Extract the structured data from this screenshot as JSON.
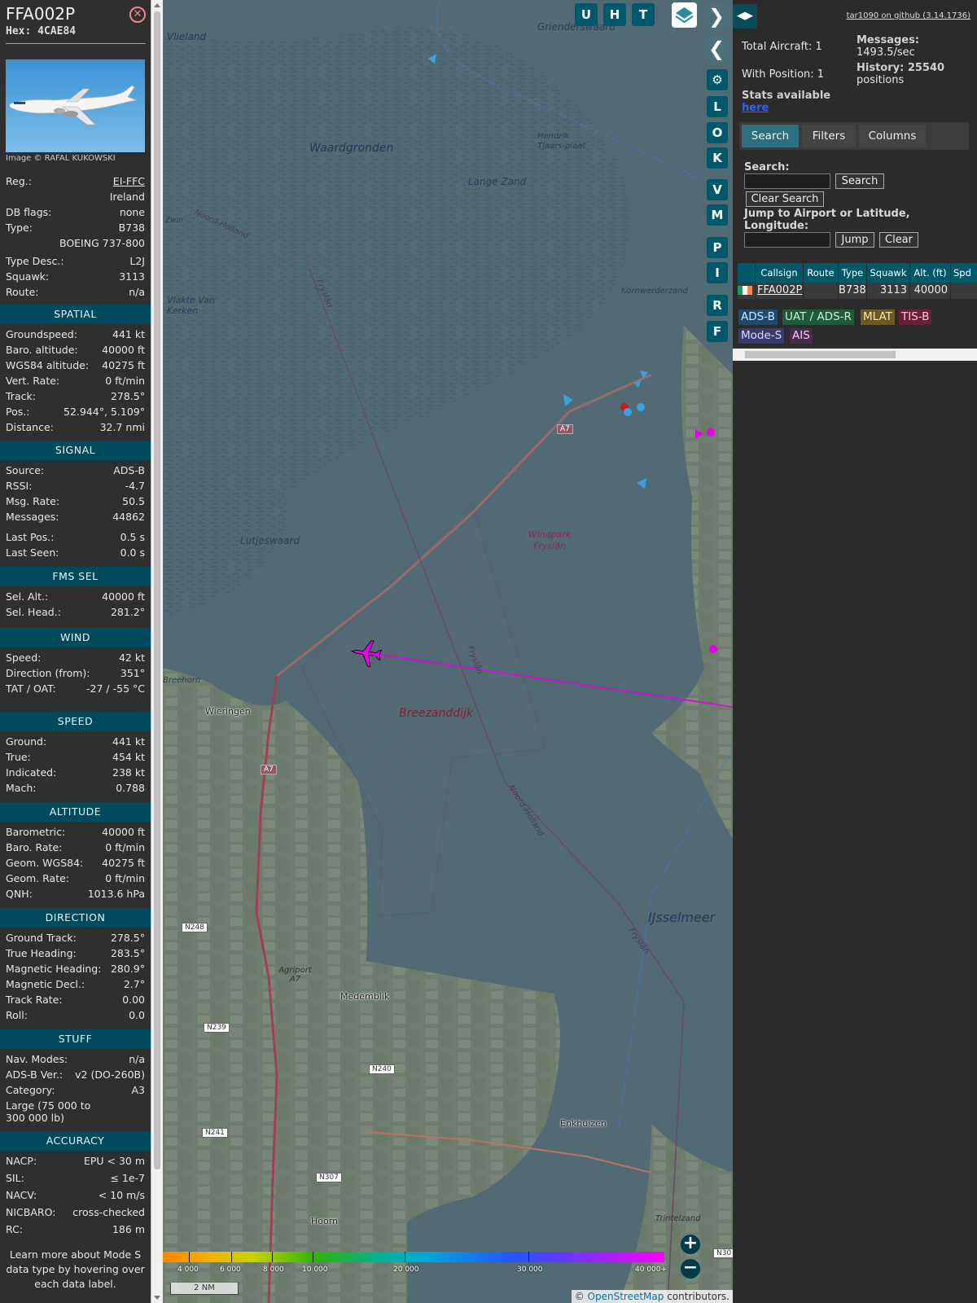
{
  "selected": {
    "callsign": "FFA002P",
    "hex": "Hex: 4CAE84",
    "photo_credit": "Image © RAFAL KUKOWSKI",
    "rows_top": [
      {
        "k": "Reg.:",
        "v": "EI-FFC",
        "link": true
      },
      {
        "k": "",
        "v": "Ireland"
      },
      {
        "k": "DB flags:",
        "v": "none"
      },
      {
        "k": "Type:",
        "v": "B738"
      },
      {
        "k": "",
        "v": "BOEING 737-800"
      },
      {
        "k": "Type Desc.:",
        "v": "L2J"
      },
      {
        "k": "Squawk:",
        "v": "3113"
      },
      {
        "k": "Route:",
        "v": "n/a"
      }
    ]
  },
  "sections": [
    {
      "title": "SPATIAL",
      "rows": [
        {
          "k": "Groundspeed:",
          "v": "441 kt"
        },
        {
          "k": "Baro. altitude:",
          "v": "40000 ft"
        },
        {
          "k": "WGS84 altitude:",
          "v": "40275 ft"
        },
        {
          "k": "Vert. Rate:",
          "v": "0 ft/min"
        },
        {
          "k": "Track:",
          "v": "278.5°"
        },
        {
          "k": "Pos.:",
          "v": "52.944°, 5.109°"
        },
        {
          "k": "Distance:",
          "v": "32.7 nmi"
        }
      ]
    },
    {
      "title": "SIGNAL",
      "rows": [
        {
          "k": "Source:",
          "v": "ADS-B"
        },
        {
          "k": "RSSI:",
          "v": "-4.7"
        },
        {
          "k": "Msg. Rate:",
          "v": "50.5"
        },
        {
          "k": "Messages:",
          "v": "44862"
        },
        {
          "k": "Last Pos.:",
          "v": "0.5 s"
        },
        {
          "k": "Last Seen:",
          "v": "0.0 s"
        }
      ]
    },
    {
      "title": "FMS SEL",
      "rows": [
        {
          "k": "Sel. Alt.:",
          "v": "40000 ft"
        },
        {
          "k": "Sel. Head.:",
          "v": "281.2°"
        }
      ]
    },
    {
      "title": "WIND",
      "rows": [
        {
          "k": "Speed:",
          "v": "42 kt"
        },
        {
          "k": "Direction (from):",
          "v": "351°"
        },
        {
          "k": "TAT / OAT:",
          "v": "-27 / -55 °C"
        }
      ]
    },
    {
      "title": "SPEED",
      "rows": [
        {
          "k": "Ground:",
          "v": "441 kt"
        },
        {
          "k": "True:",
          "v": "454 kt"
        },
        {
          "k": "Indicated:",
          "v": "238 kt"
        },
        {
          "k": "Mach:",
          "v": "0.788"
        }
      ]
    },
    {
      "title": "ALTITUDE",
      "rows": [
        {
          "k": "Barometric:",
          "v": "40000 ft"
        },
        {
          "k": "Baro. Rate:",
          "v": "0 ft/min"
        },
        {
          "k": "Geom. WGS84:",
          "v": "40275 ft"
        },
        {
          "k": "Geom. Rate:",
          "v": "0 ft/min"
        },
        {
          "k": "QNH:",
          "v": "1013.6 hPa"
        }
      ]
    },
    {
      "title": "DIRECTION",
      "rows": [
        {
          "k": "Ground Track:",
          "v": "278.5°"
        },
        {
          "k": "True Heading:",
          "v": "283.5°"
        },
        {
          "k": "Magnetic Heading:",
          "v": "280.9°"
        },
        {
          "k": "Magnetic Decl.:",
          "v": "2.7°"
        },
        {
          "k": "Track Rate:",
          "v": "0.00"
        },
        {
          "k": "Roll:",
          "v": "0.0"
        }
      ]
    },
    {
      "title": "STUFF",
      "rows": [
        {
          "k": "Nav. Modes:",
          "v": "n/a"
        },
        {
          "k": "ADS-B Ver.:",
          "v": "v2 (DO-260B)"
        },
        {
          "k": "Category:",
          "v": "A3"
        },
        {
          "k": "Large (75 000 to 300 000 lb)",
          "v": "",
          "wrap": true
        }
      ]
    },
    {
      "title": "ACCURACY",
      "rows": [
        {
          "k": "NACP:",
          "v": "EPU < 30 m"
        },
        {
          "k": "SIL:",
          "v": "≤ 1e-7"
        },
        {
          "k": "NACV:",
          "v": "< 10 m/s"
        },
        {
          "k": "NICBARO:",
          "v": "cross-checked"
        },
        {
          "k": "RC:",
          "v": "186 m"
        }
      ]
    }
  ],
  "learn_more": "Learn more about Mode S data type by hovering over each data label.",
  "map": {
    "buttons_top": [
      "U",
      "H",
      "T"
    ],
    "buttons_side": [
      "L",
      "O",
      "K",
      "V",
      "M",
      "P",
      "I",
      "R",
      "F"
    ],
    "labels": {
      "vlieland": "Vlieland",
      "griend": "Griend",
      "griend_wad": "Griendersw​aard",
      "waardgronden": "Waardgronden",
      "lange_zand": "Lange Zand",
      "hendrik": "Hendrik Tjaars-plaat",
      "vlakte": "Vlakte Van Kerken",
      "kornwerderzand": "Kornwerderzand",
      "windpark": "Windpark Fryslân",
      "lutjeswaard": "Lutjeswaard",
      "breezanddijk": "Breezanddijk",
      "wieringen": "Wieringen",
      "ijsselmeer": "IJsselmeer",
      "medemblik": "Medemblik",
      "enkhuizen": "Enkhuizen",
      "hoorn": "Hoorn",
      "agriport": "Agriport A7",
      "trintelzand": "Trintelzand",
      "noord_holland": "Noord-Holland",
      "fryslan": "Fryslân",
      "breehorn": "Breehorn",
      "zwin": "Zwin"
    },
    "shields": [
      "A7",
      "A7",
      "N248",
      "N239",
      "N240",
      "N241",
      "N307",
      "N30"
    ],
    "scale_labels": [
      "4 000",
      "6 000",
      "8 000",
      "10 000",
      "20 000",
      "30 000",
      "40 000+"
    ],
    "distance_scale": "2 NM",
    "attribution_prefix": "© ",
    "attribution_link": "OpenStreetMap",
    "attribution_suffix": " contributors."
  },
  "side": {
    "github": "tar1090 on github (3.14.1736)",
    "total_aircraft": "Total Aircraft: 1",
    "with_position": "With Position: 1",
    "stats_label": "Stats available",
    "stats_link": "here",
    "messages_label": "Messages:",
    "messages_value": "1493.5/sec",
    "history_label": "History: 25540",
    "history_value": "positions",
    "tabs": [
      "Search",
      "Filters",
      "Columns"
    ],
    "search_label": "Search:",
    "search_btn": "Search",
    "clear_search_btn": "Clear Search",
    "jump_label": "Jump to Airport or Latitude, Longitude:",
    "jump_btn": "Jump",
    "clear_btn": "Clear",
    "table_headers": [
      "",
      "Callsign",
      "Route",
      "Type",
      "Squawk",
      "Alt. (ft)",
      "Spd"
    ],
    "table_row": {
      "callsign": "FFA002P",
      "route": "",
      "type": "B738",
      "squawk": "3113",
      "alt": "40000",
      "spd": ""
    },
    "badges": [
      "ADS-B",
      "UAT / ADS-R",
      "MLAT",
      "TIS-B",
      "Mode-S",
      "AIS"
    ]
  },
  "colors": {
    "section_header": "#004a5e",
    "track_line": "#e600e6",
    "aircraft": "#e600e6",
    "badge_adsb": "#1f4a6e",
    "badge_uat": "#1f5a3a",
    "badge_mlat": "#6a5a22",
    "badge_tisb": "#6a1f3a",
    "badge_modes": "#3a3a6e",
    "badge_ais": "#4a2a4a"
  }
}
